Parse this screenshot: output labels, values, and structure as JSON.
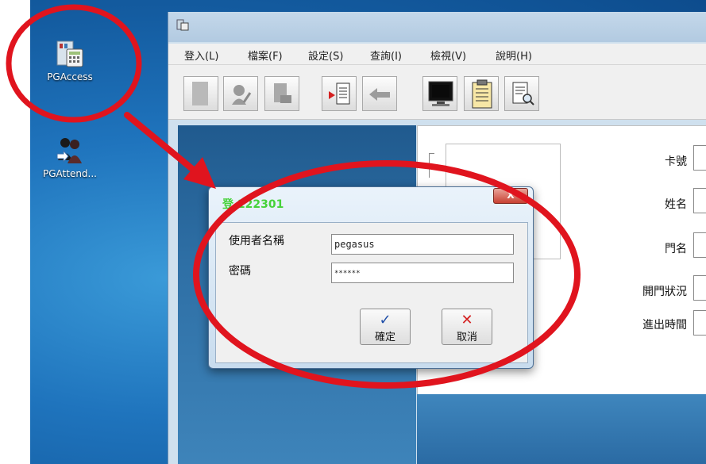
{
  "desktop": {
    "icons": [
      {
        "label": "PGAccess",
        "icon": "calculator-building-icon"
      },
      {
        "label": "PGAttend...",
        "icon": "people-icon"
      }
    ]
  },
  "app": {
    "menu": [
      "登入(L)",
      "檔案(F)",
      "設定(S)",
      "查詢(I)",
      "檢視(V)",
      "說明(H)"
    ],
    "form_labels": [
      "卡號",
      "姓名",
      "門名",
      "開門狀況",
      "進出時間"
    ]
  },
  "dialog": {
    "title": "登 122301",
    "close_glyph": "X",
    "username_label": "使用者名稱",
    "username_value": "pegasus",
    "password_label": "密碼",
    "password_value": "******",
    "ok_label": "確定",
    "ok_glyph": "✓",
    "cancel_label": "取消",
    "cancel_glyph": "✕"
  },
  "colors": {
    "annotation_red": "#e0141e",
    "dialog_title_green": "#46d23a"
  }
}
